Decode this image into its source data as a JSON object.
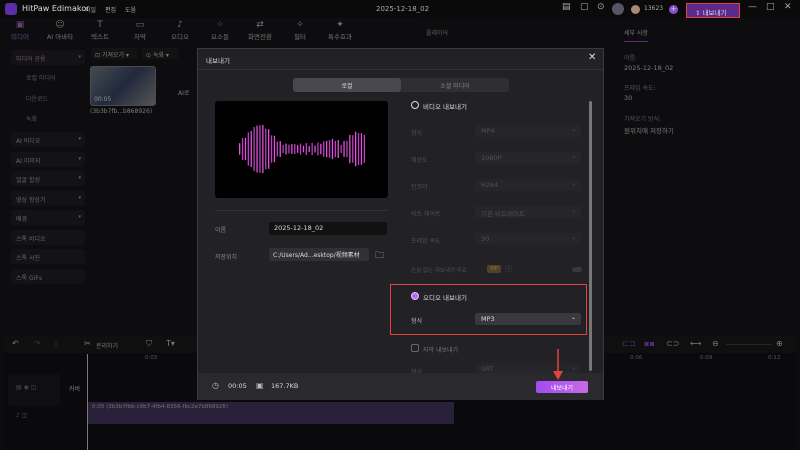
{
  "app": {
    "title": "HitPaw Edimakor",
    "menus": [
      "파일",
      "편집",
      "도움"
    ],
    "project_name": "2025-12-18_02",
    "credits": "13623",
    "export_label": "내보내기"
  },
  "toolbar": [
    {
      "label": "미디어",
      "icon": "▣"
    },
    {
      "label": "AI 아바타",
      "icon": "☺"
    },
    {
      "label": "텍스트",
      "icon": "T"
    },
    {
      "label": "자막",
      "icon": "▭"
    },
    {
      "label": "오디오",
      "icon": "♪"
    },
    {
      "label": "요소들",
      "icon": "⁘"
    },
    {
      "label": "화면전환",
      "icon": "⇄"
    },
    {
      "label": "필터",
      "icon": "✧"
    },
    {
      "label": "특수효과",
      "icon": "✦"
    }
  ],
  "sidebar": {
    "library": "미디어 공용",
    "subs": [
      "로컬 미디어",
      "다운로드",
      "녹화"
    ],
    "items": [
      "AI 비디오",
      "AI 이미지",
      "얼굴 합성",
      "영상 향상기",
      "배경",
      "스톡 비디오",
      "스톡 사진",
      "스톡 GIFs"
    ]
  },
  "media": {
    "import": "가져오기",
    "record": "녹화",
    "clip_duration": "00:05",
    "clip_name": "(3b3b7fb...b868926)",
    "ai_label": "AI로 "
  },
  "player": {
    "title": "플레이어"
  },
  "details": {
    "tab": "세부 사항",
    "name_label": "이름:",
    "name": "2025-12-18_02",
    "fps_label": "프레임 속도:",
    "fps": "30",
    "import_label": "가져오기 방식:",
    "import_value": "원위치에 저장하기"
  },
  "timeline": {
    "split": "분리하기",
    "times": [
      "0:03",
      "0:06",
      "0:09",
      "0:12"
    ],
    "cover": "커버",
    "audio_clip": "0:05 (3b3b7fbb-c9b7-4fb4-8356-fbc2e7b868926)"
  },
  "dialog": {
    "title": "내보내기",
    "tabs": [
      "로컬",
      "소셜 미디어"
    ],
    "name_label": "이름",
    "name_value": "2025-12-18_02",
    "path_label": "저장위치",
    "path_value": "C:/Users/Ad...esktop/视频素材",
    "video_export": "비디오 내보내기",
    "video_rows": [
      {
        "label": "형식",
        "value": "MP4"
      },
      {
        "label": "해상도",
        "value": "1080P"
      },
      {
        "label": "인코더",
        "value": "H264"
      },
      {
        "label": "비트 레이트",
        "value": "기본 비트레이트"
      },
      {
        "label": "프레임 속도",
        "value": "30"
      }
    ],
    "lossless": "손실 없는 내보내기 무료",
    "vip": "VIP",
    "audio_export": "오디오 내보내기",
    "audio_format_label": "형식",
    "audio_format": "MP3",
    "subtitle_export": "자막 내보내기",
    "subtitle_format_label": "형식",
    "subtitle_format": "SRT",
    "duration": "00:05",
    "size": "167.7KB",
    "export_button": "내보내기"
  },
  "colors": {
    "accent": "#9b4de0",
    "highlight": "#e0443a"
  }
}
